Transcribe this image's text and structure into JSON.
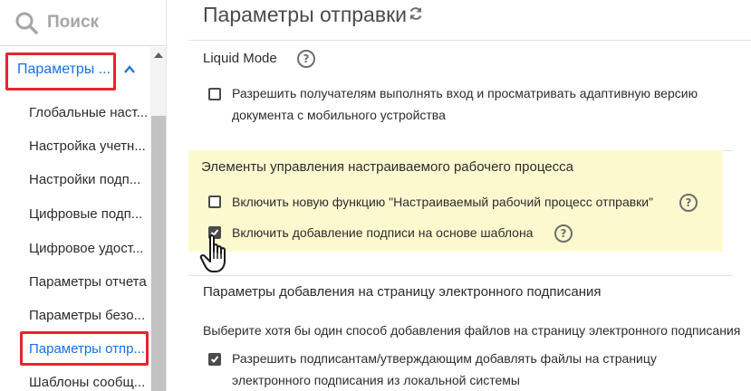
{
  "sidebar": {
    "search_label": "Поиск",
    "group_label": "Параметры ...",
    "items": [
      {
        "label": "Глобальные наст..."
      },
      {
        "label": "Настройка учетн..."
      },
      {
        "label": "Настройки подп..."
      },
      {
        "label": "Цифровые подп..."
      },
      {
        "label": "Цифровое удост..."
      },
      {
        "label": "Параметры отчета"
      },
      {
        "label": "Параметры безо..."
      },
      {
        "label": "Параметры отпр..."
      },
      {
        "label": "Шаблоны сообщ..."
      }
    ]
  },
  "main": {
    "title": "Параметры отправки",
    "liquid": {
      "heading": "Liquid Mode",
      "option1_line1": "Разрешить получателям выполнять вход и просматривать адаптивную версию",
      "option1_line2": "документа с мобильного устройства"
    },
    "workflow": {
      "heading": "Элементы управления настраиваемого рабочего процесса",
      "option1": "Включить новую функцию \"Настраиваемый рабочий процесс отправки\"",
      "option2": "Включить добавление подписи на основе шаблона"
    },
    "esign": {
      "heading": "Параметры добавления на страницу электронного подписания",
      "description": "Выберите хотя бы один способ добавления файлов на страницу электронного подписания",
      "option1_line1": "Разрешить подписантам/утверждающим добавлять файлы на страницу",
      "option1_line2": "электронного подписания из локальной системы"
    }
  },
  "colors": {
    "accent": "#1473e6",
    "highlight_red": "#e5252f",
    "yellow_highlight": "#fdf9cf"
  },
  "icons": [
    "search-icon",
    "chevron-up-icon",
    "refresh-icon",
    "help-icon",
    "checkmark-icon",
    "hand-cursor-icon"
  ]
}
